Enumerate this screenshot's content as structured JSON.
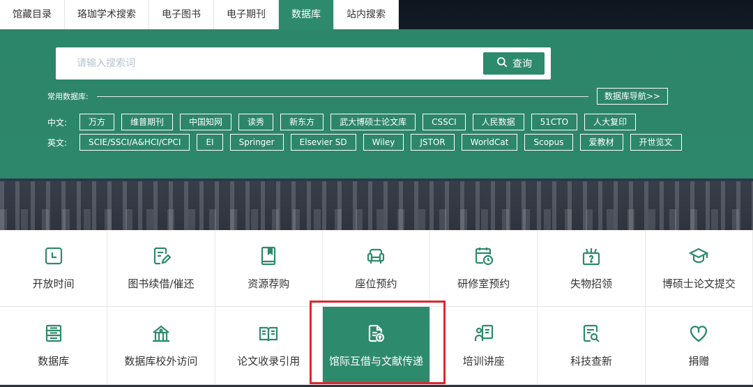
{
  "tabs": [
    {
      "label": "馆藏目录",
      "active": false
    },
    {
      "label": "珞珈学术搜索",
      "active": false
    },
    {
      "label": "电子图书",
      "active": false
    },
    {
      "label": "电子期刊",
      "active": false
    },
    {
      "label": "数据库",
      "active": true
    },
    {
      "label": "站内搜索",
      "active": false
    }
  ],
  "search": {
    "placeholder": "请输入搜索词",
    "button_label": "查询"
  },
  "common": {
    "label": "常用数据库:",
    "nav_button": "数据库导航>>"
  },
  "chinese_dbs": {
    "label": "中文:",
    "items": [
      "万方",
      "维普期刊",
      "中国知网",
      "读秀",
      "新东方",
      "武大博硕士论文库",
      "CSSCI",
      "人民数据",
      "51CTO",
      "人大复印"
    ]
  },
  "english_dbs": {
    "label": "英文:",
    "items": [
      "SCIE/SSCI/A&HCI/CPCI",
      "EI",
      "Springer",
      "Elsevier SD",
      "Wiley",
      "JSTOR",
      "WorldCat",
      "Scopus",
      "爱教材",
      "开世览文"
    ]
  },
  "services": [
    {
      "label": "开放时间",
      "icon": "clock-icon"
    },
    {
      "label": "图书续借/催还",
      "icon": "book-edit-icon"
    },
    {
      "label": "资源荐购",
      "icon": "bookmark-book-icon"
    },
    {
      "label": "座位预约",
      "icon": "armchair-icon"
    },
    {
      "label": "研修室预约",
      "icon": "calendar-clock-icon"
    },
    {
      "label": "失物招领",
      "icon": "lost-found-box-icon"
    },
    {
      "label": "博硕士论文提交",
      "icon": "graduation-cap-icon"
    },
    {
      "label": "数据库",
      "icon": "database-icon"
    },
    {
      "label": "数据库校外访问",
      "icon": "building-icon"
    },
    {
      "label": "论文收录引用",
      "icon": "open-book-icon"
    },
    {
      "label": "馆际互借与文献传递",
      "icon": "document-upload-icon",
      "highlighted": true
    },
    {
      "label": "培训讲座",
      "icon": "lecture-icon"
    },
    {
      "label": "科技查新",
      "icon": "document-search-icon"
    },
    {
      "label": "捐赠",
      "icon": "heart-icon"
    }
  ],
  "colors": {
    "brand_green": "#2e8a6c",
    "highlight_border": "#e0262b"
  }
}
